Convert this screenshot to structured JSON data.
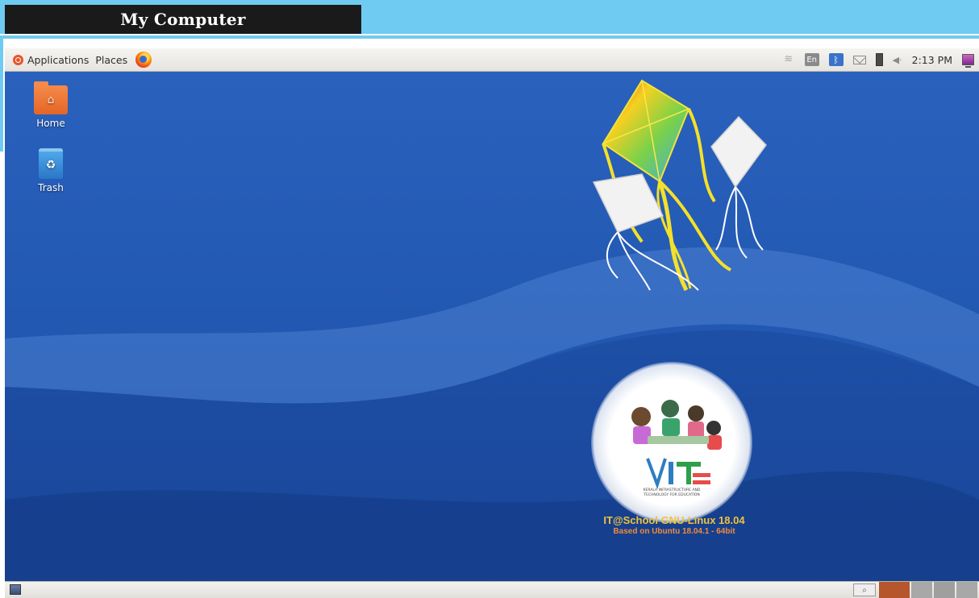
{
  "heading": {
    "title": "My Computer"
  },
  "top_panel": {
    "menus": [
      "Applications",
      "Places"
    ],
    "keyboard_layout": "En",
    "clock": "2:13 PM"
  },
  "desktop_icons": [
    {
      "label": "Home",
      "icon": "home-folder-icon"
    },
    {
      "label": "Trash",
      "icon": "trash-icon"
    }
  ],
  "branding": {
    "title": "IT@School GNU-Linux 18.04",
    "subtitle": "Based on Ubuntu 18.04.1 - 64bit",
    "logo_text": "ITE",
    "logo_caption_1": "KERALA INFRASTRUCTURE AND",
    "logo_caption_2": "TECHNOLOGY FOR EDUCATION"
  },
  "colors": {
    "heading_band": "#6fcbf1",
    "wallpaper_blue": "#1d4fa4",
    "brand_yellow": "#f2c23a",
    "brand_orange": "#f28b3a"
  }
}
